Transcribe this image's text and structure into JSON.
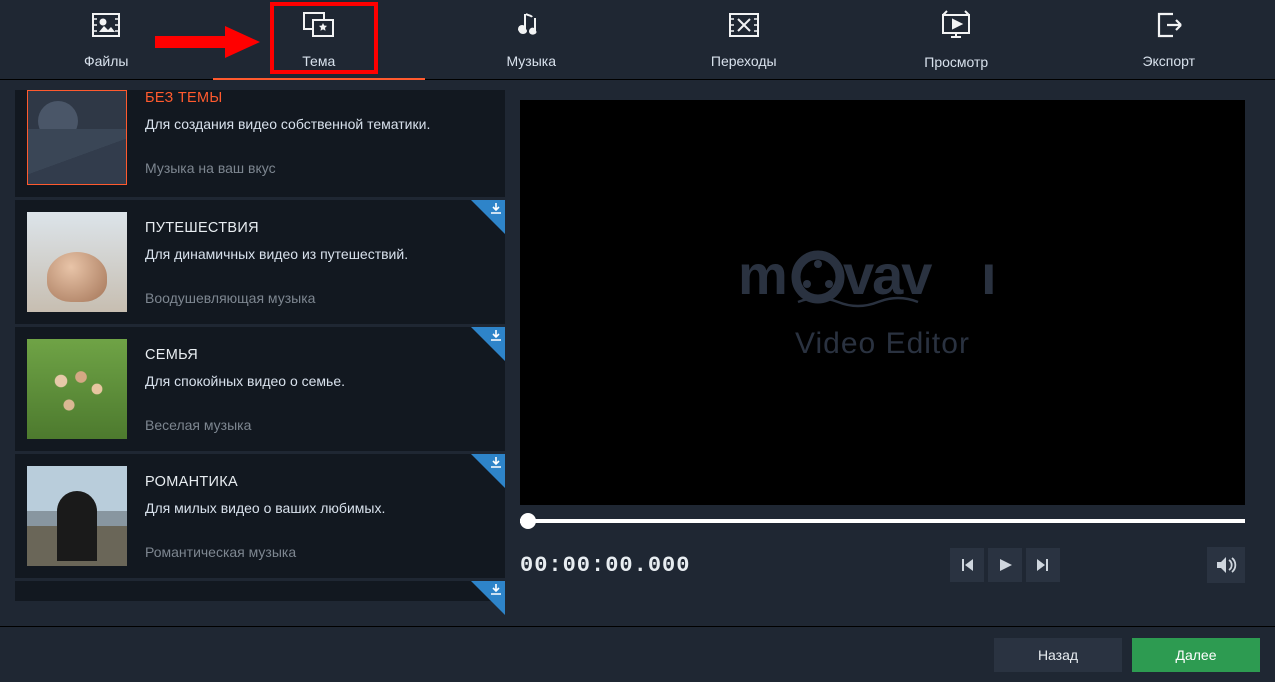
{
  "tabs": {
    "files": "Файлы",
    "theme": "Тема",
    "music": "Музыка",
    "transitions": "Переходы",
    "preview": "Просмотр",
    "export": "Экспорт"
  },
  "themes": {
    "notheme": {
      "title": "БЕЗ ТЕМЫ",
      "desc": "Для создания видео собственной тематики.",
      "music": "Музыка на ваш вкус"
    },
    "travel": {
      "title": "ПУТЕШЕСТВИЯ",
      "desc": "Для динамичных видео из путешествий.",
      "music": "Воодушевляющая музыка"
    },
    "family": {
      "title": "СЕМЬЯ",
      "desc": "Для спокойных видео о семье.",
      "music": "Веселая музыка"
    },
    "romance": {
      "title": "РОМАНТИКА",
      "desc": "Для милых видео о ваших любимых.",
      "music": "Романтическая музыка"
    }
  },
  "preview": {
    "brand": "movavi",
    "subtitle": "Video Editor",
    "timecode": "00:00:00.000"
  },
  "footer": {
    "back": "Назад",
    "next": "Далее"
  }
}
